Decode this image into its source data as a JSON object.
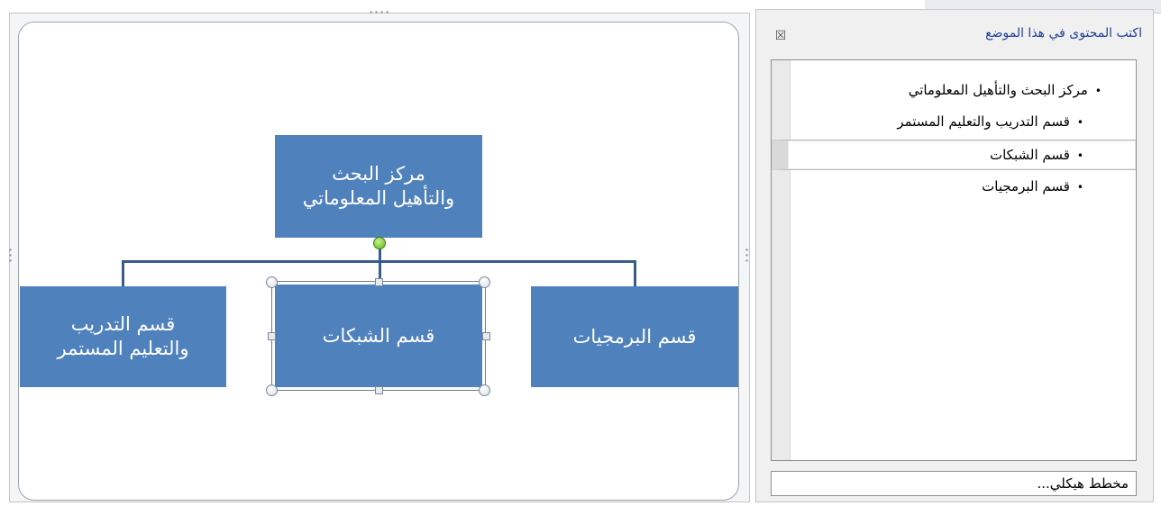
{
  "pane": {
    "title": "اكتب المحتوى في هذا الموضع",
    "close_symbol": "☒",
    "items": [
      {
        "text": "مركز البحث والتأهيل المعلوماتي",
        "level": 1
      },
      {
        "text": "قسم التدريب والتعليم المستمر",
        "level": 2
      },
      {
        "text": "قسم الشبكات",
        "level": 2,
        "selected": true
      },
      {
        "text": "قسم البرمجيات",
        "level": 2
      }
    ],
    "bullet": "•",
    "footer_link": "مخطط هيكلي..."
  },
  "diagram": {
    "root": "مركز البحث\nوالتأهيل المعلوماتي",
    "child_left": "قسم التدريب\nوالتعليم المستمر",
    "child_center": "قسم الشبكات",
    "child_right": "قسم البرمجيات",
    "box_color": "#4f81bd",
    "connector_color": "#385d8a"
  }
}
